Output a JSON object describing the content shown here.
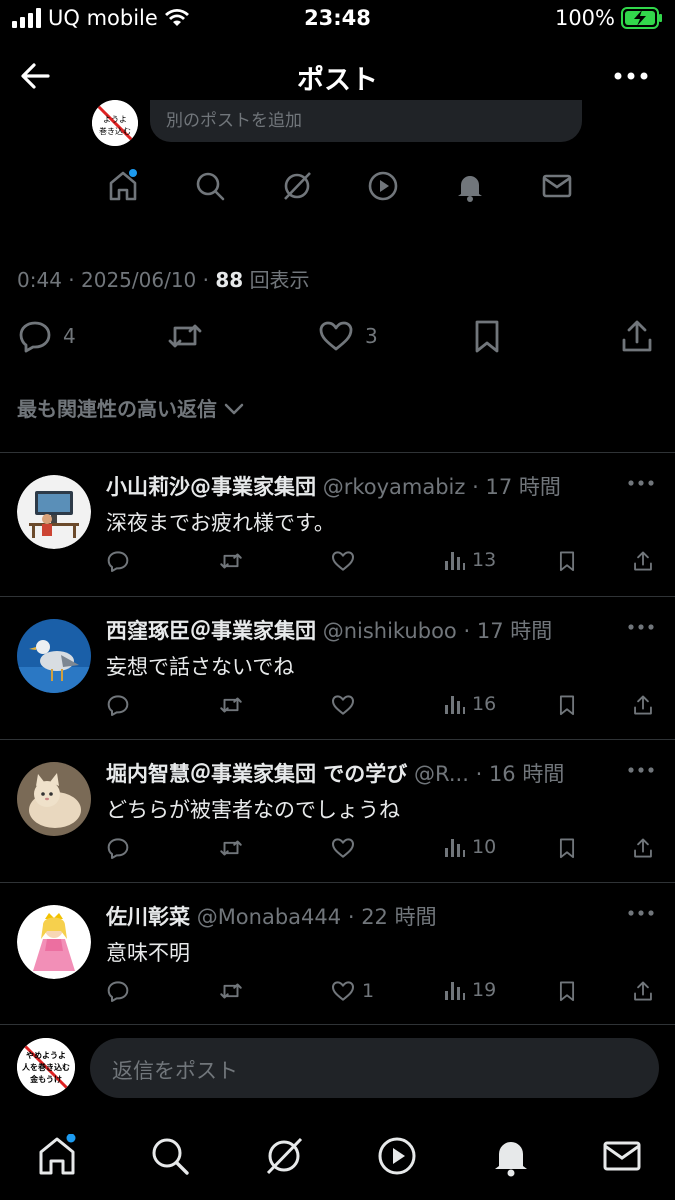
{
  "status_bar": {
    "carrier": "UQ mobile",
    "time": "23:48",
    "battery": "100%"
  },
  "header": {
    "title": "ポスト"
  },
  "compose": {
    "placeholder": "別のポストを追加",
    "avatar_text": "やめようよ人を巻き込む"
  },
  "post_meta": {
    "time": "0:44",
    "date": "2025/06/10",
    "views": "88",
    "views_label": "回表示"
  },
  "post_actions": {
    "replies": "4",
    "likes": "3"
  },
  "sort_label": "最も関連性の高い返信",
  "replies": [
    {
      "name": "小山莉沙@事業家集団",
      "handle": "@rkoyamabiz",
      "time": "17 時間",
      "text": "深夜までお疲れ様です。",
      "likes": "",
      "views": "13"
    },
    {
      "name": "西窪琢臣＠事業家集団",
      "handle": "@nishikuboo",
      "time": "17 時間",
      "text": "妄想で話さないでね",
      "likes": "",
      "views": "16"
    },
    {
      "name": "堀内智慧＠事業家集団 での学び",
      "handle": "@R...",
      "time": "16 時間",
      "text": "どちらが被害者なのでしょうね",
      "likes": "",
      "views": "10"
    },
    {
      "name": "佐川彰菜",
      "handle": "@Monaba444",
      "time": "22 時間",
      "text": "意味不明",
      "likes": "1",
      "views": "19"
    }
  ],
  "reply_bar": {
    "placeholder": "返信をポスト",
    "avatar_text": "やめようよ人を巻き込む金もうけ"
  },
  "colors": {
    "background": "#000000",
    "accent": "#1d9bf0",
    "muted": "#71767b",
    "battery": "#32d74b"
  },
  "icons": [
    "back-arrow-icon",
    "more-icon",
    "home-icon",
    "search-icon",
    "grok-icon",
    "video-icon",
    "bell-icon",
    "mail-icon",
    "reply-icon",
    "repost-icon",
    "like-icon",
    "bookmark-icon",
    "share-icon",
    "analytics-icon"
  ]
}
